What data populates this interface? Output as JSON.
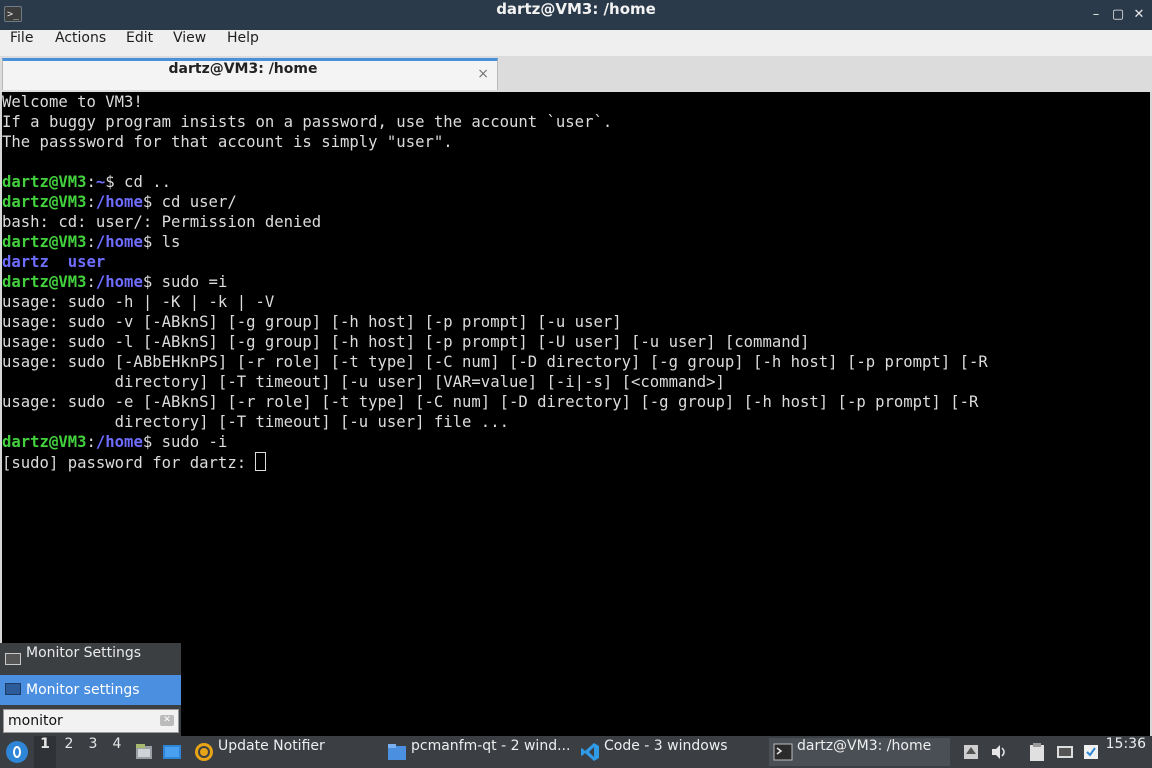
{
  "window": {
    "title": "dartz@VM3: /home",
    "controls": [
      "minimize-icon",
      "maximize-icon",
      "close-icon"
    ]
  },
  "menu": [
    "File",
    "Actions",
    "Edit",
    "View",
    "Help"
  ],
  "tab": {
    "label": "dartz@VM3: /home",
    "close": "×"
  },
  "terminal": {
    "colors": {
      "background": "#000000",
      "text": "#dcdcdc",
      "user": "#44d13e",
      "path": "#6f6dff"
    },
    "lines": [
      [
        {
          "t": "Welcome to VM3!"
        }
      ],
      [
        {
          "t": "If a buggy program insists on a password, use the account `user`."
        }
      ],
      [
        {
          "t": "The passsword for that account is simply \"user\"."
        }
      ],
      [
        {
          "t": ""
        }
      ],
      [
        {
          "t": "dartz@VM3",
          "c": "pu"
        },
        {
          "t": ":"
        },
        {
          "t": "~",
          "c": "pp"
        },
        {
          "t": "$ cd .."
        }
      ],
      [
        {
          "t": "dartz@VM3",
          "c": "pu"
        },
        {
          "t": ":"
        },
        {
          "t": "/home",
          "c": "pp"
        },
        {
          "t": "$ cd user/"
        }
      ],
      [
        {
          "t": "bash: cd: user/: Permission denied"
        }
      ],
      [
        {
          "t": "dartz@VM3",
          "c": "pu"
        },
        {
          "t": ":"
        },
        {
          "t": "/home",
          "c": "pp"
        },
        {
          "t": "$ ls"
        }
      ],
      [
        {
          "t": "dartz",
          "c": "dir"
        },
        {
          "t": "  "
        },
        {
          "t": "user",
          "c": "dir"
        }
      ],
      [
        {
          "t": "dartz@VM3",
          "c": "pu"
        },
        {
          "t": ":"
        },
        {
          "t": "/home",
          "c": "pp"
        },
        {
          "t": "$ sudo =i"
        }
      ],
      [
        {
          "t": "usage: sudo -h | -K | -k | -V"
        }
      ],
      [
        {
          "t": "usage: sudo -v [-ABknS] [-g group] [-h host] [-p prompt] [-u user]"
        }
      ],
      [
        {
          "t": "usage: sudo -l [-ABknS] [-g group] [-h host] [-p prompt] [-U user] [-u user] [command]"
        }
      ],
      [
        {
          "t": "usage: sudo [-ABbEHknPS] [-r role] [-t type] [-C num] [-D directory] [-g group] [-h host] [-p prompt] [-R"
        }
      ],
      [
        {
          "t": "            directory] [-T timeout] [-u user] [VAR=value] [-i|-s] [<command>]"
        }
      ],
      [
        {
          "t": "usage: sudo -e [-ABknS] [-r role] [-t type] [-C num] [-D directory] [-g group] [-h host] [-p prompt] [-R"
        }
      ],
      [
        {
          "t": "            directory] [-T timeout] [-u user] file ..."
        }
      ],
      [
        {
          "t": "dartz@VM3",
          "c": "pu"
        },
        {
          "t": ":"
        },
        {
          "t": "/home",
          "c": "pp"
        },
        {
          "t": "$ sudo -i"
        }
      ],
      [
        {
          "t": "[sudo] password for dartz: "
        },
        {
          "cursor": true
        }
      ]
    ]
  },
  "launcher": {
    "items": [
      {
        "label": "Monitor Settings",
        "icon": "monitor-icon"
      },
      {
        "label": "Monitor settings",
        "icon": "monitor-icon",
        "selected": true
      }
    ],
    "search_value": "monitor",
    "clear_icon": "clear-icon"
  },
  "taskbar": {
    "start_icon": "start-menu-icon",
    "workspaces": [
      "1",
      "2",
      "3",
      "4"
    ],
    "active_workspace": "1",
    "quicklaunch": [
      "file-manager-icon",
      "show-desktop-icon"
    ],
    "tasks": [
      {
        "label": "Update Notifier",
        "icon": "update-notifier-icon"
      },
      {
        "label": "pcmanfm-qt - 2 wind...",
        "icon": "folder-icon"
      },
      {
        "label": "Code - 3 windows",
        "icon": "vscode-icon"
      },
      {
        "label": "dartz@VM3: /home",
        "icon": "terminal-icon",
        "active": true
      }
    ],
    "tray": [
      "tray-arrow-icon",
      "volume-icon",
      "clipboard-icon",
      "network-icon",
      "updates-icon"
    ],
    "clock": "15:36"
  }
}
